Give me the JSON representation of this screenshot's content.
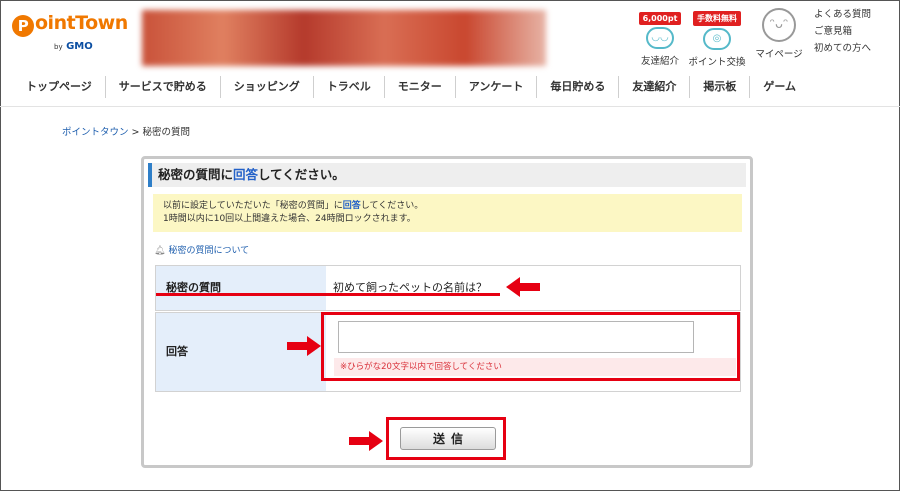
{
  "header": {
    "logo_text": "ointTown",
    "logo_initial": "P",
    "logo_by": "by",
    "logo_gmo": "GMO",
    "icons": [
      {
        "badge": "6,000pt",
        "label": "友達紹介",
        "icon": "smile-icon"
      },
      {
        "badge": "手数料無料",
        "label": "ポイント交換",
        "icon": "coin-exchange-icon"
      },
      {
        "label": "マイページ",
        "icon": "avatar-icon"
      }
    ],
    "links": [
      "よくある質問",
      "ご意見箱",
      "初めての方へ"
    ]
  },
  "nav": {
    "items": [
      "トップページ",
      "サービスで貯める",
      "ショッピング",
      "トラベル",
      "モニター",
      "アンケート",
      "毎日貯める",
      "友達紹介",
      "掲示板",
      "ゲーム"
    ]
  },
  "breadcrumb": {
    "home": "ポイントタウン",
    "separator": ">",
    "current": "秘密の質問"
  },
  "panel": {
    "title_pre": "秘密の質問に",
    "title_kw": "回答",
    "title_post": "してください。",
    "notice_line1_pre": "以前に設定していただいた「秘密の質問」に",
    "notice_line1_kw": "回答",
    "notice_line1_post": "してください。",
    "notice_line2": "1時間以内に10回以上間違えた場合、24時間ロックされます。",
    "about_link": "秘密の質問について",
    "question_label": "秘密の質問",
    "question_text": "初めて飼ったペットの名前は？",
    "answer_label": "回答",
    "answer_value": "",
    "answer_hint": "※ひらがな20文字以内で回答してください",
    "submit_label": "送信"
  },
  "colors": {
    "accent_red": "#e60012",
    "brand_orange": "#f07800",
    "link_blue": "#1f5fae",
    "label_bg": "#e4eefa"
  }
}
